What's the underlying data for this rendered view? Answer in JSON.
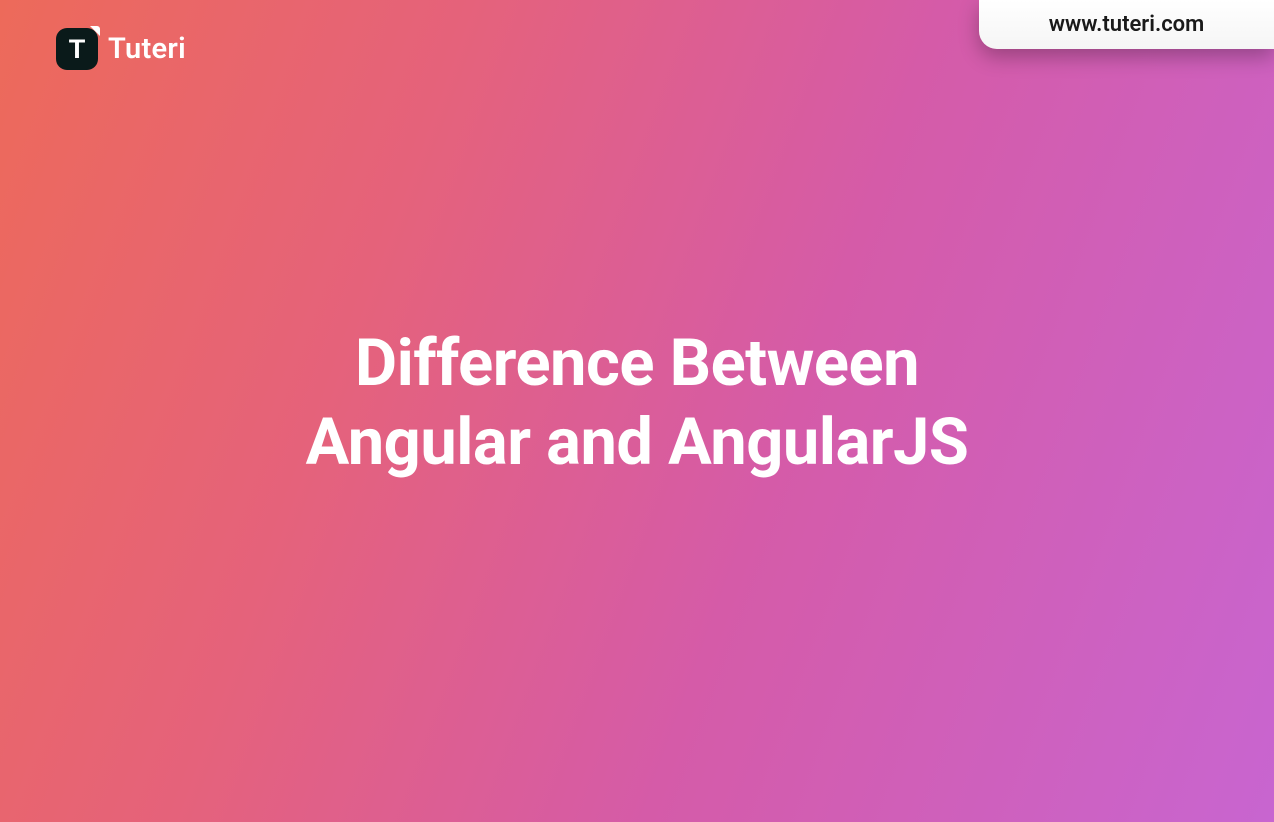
{
  "logo": {
    "letter": "T",
    "brand": "Tuteri"
  },
  "url_badge": {
    "text": "www.tuteri.com"
  },
  "title": {
    "line1": "Difference Between",
    "line2": "Angular and AngularJS"
  }
}
